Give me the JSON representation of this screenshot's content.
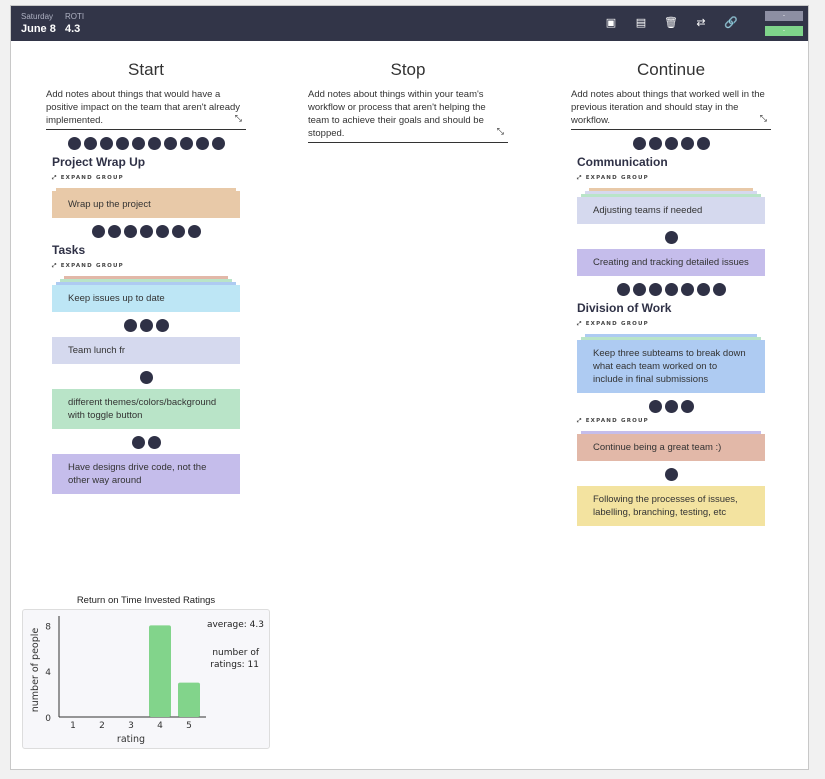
{
  "header": {
    "day_label": "Saturday",
    "date": "June 8",
    "roti_label": "ROTI",
    "roti_value": "4.3",
    "icons": [
      "export-pdf-icon",
      "export-doc-icon",
      "trash-icon",
      "refresh-icon",
      "link-icon"
    ],
    "button_top": "-",
    "button_bottom": "-"
  },
  "colors": {
    "header": "#323548",
    "dot": "#2f3146",
    "tan": "#e8c9a8",
    "lightblue": "#bde6f5",
    "lavender": "#d5d9ee",
    "green": "#b9e4c8",
    "purple": "#c5bdeb",
    "salmon": "#e2b8a8",
    "blue": "#aecbf2",
    "yellow": "#f3e3a0"
  },
  "expand_label": "EXPAND GROUP",
  "columns": [
    {
      "title": "Start",
      "description": "Add notes about things that would have a positive impact on the team that aren't already implemented.",
      "items": [
        {
          "type": "votes",
          "count": 10
        },
        {
          "type": "group",
          "title": "Project Wrap Up"
        },
        {
          "type": "expand"
        },
        {
          "type": "card",
          "text": "Wrap up the project",
          "color": "tan",
          "layers": [
            "tan"
          ]
        },
        {
          "type": "votes",
          "count": 7
        },
        {
          "type": "group",
          "title": "Tasks"
        },
        {
          "type": "expand"
        },
        {
          "type": "card",
          "text": "Keep issues up to date",
          "color": "lightblue",
          "layers": [
            "salmon",
            "green",
            "blue"
          ]
        },
        {
          "type": "votes",
          "count": 3
        },
        {
          "type": "card",
          "text": "Team lunch fr",
          "color": "lavender",
          "layers": []
        },
        {
          "type": "votes",
          "count": 1
        },
        {
          "type": "card",
          "text": "different themes/colors/background with toggle button",
          "color": "green",
          "layers": []
        },
        {
          "type": "votes",
          "count": 2
        },
        {
          "type": "card",
          "text": "Have designs drive code, not the other way around",
          "color": "purple",
          "layers": []
        }
      ]
    },
    {
      "title": "Stop",
      "description": "Add notes about things within your team's workflow or process that aren't helping the team to achieve their goals and should be stopped.",
      "items": []
    },
    {
      "title": "Continue",
      "description": "Add notes about things that worked well in the previous iteration and should stay in the workflow.",
      "items": [
        {
          "type": "votes",
          "count": 5
        },
        {
          "type": "group",
          "title": "Communication"
        },
        {
          "type": "expand"
        },
        {
          "type": "card",
          "text": "Adjusting teams if needed",
          "color": "lavender",
          "layers": [
            "tan",
            "lavender",
            "green"
          ]
        },
        {
          "type": "votes",
          "count": 1
        },
        {
          "type": "card",
          "text": "Creating and tracking detailed issues",
          "color": "purple",
          "layers": []
        },
        {
          "type": "votes",
          "count": 7
        },
        {
          "type": "group",
          "title": "Division of Work"
        },
        {
          "type": "expand"
        },
        {
          "type": "card",
          "text": "Keep three subteams to break down what each team worked on to include in final submissions",
          "color": "blue",
          "layers": [
            "blue",
            "green"
          ]
        },
        {
          "type": "votes",
          "count": 3
        },
        {
          "type": "expand"
        },
        {
          "type": "card",
          "text": "Continue being a great team :)",
          "color": "salmon",
          "layers": [
            "purple"
          ]
        },
        {
          "type": "votes",
          "count": 1
        },
        {
          "type": "card",
          "text": "Following the processes of issues, labelling, branching, testing, etc",
          "color": "yellow",
          "layers": []
        }
      ]
    }
  ],
  "chart_data": {
    "type": "bar",
    "title": "Return on Time Invested Ratings",
    "xlabel": "rating",
    "ylabel": "number of people",
    "categories": [
      "1",
      "2",
      "3",
      "4",
      "5"
    ],
    "values": [
      0,
      0,
      0,
      8,
      3
    ],
    "yticks": [
      "0",
      "4",
      "8"
    ],
    "ylim": [
      0,
      8.3
    ],
    "grid": false,
    "bar_color": "#82d48b",
    "annotations": {
      "average": "average: 4.3",
      "count": "number of ratings: 11"
    }
  }
}
